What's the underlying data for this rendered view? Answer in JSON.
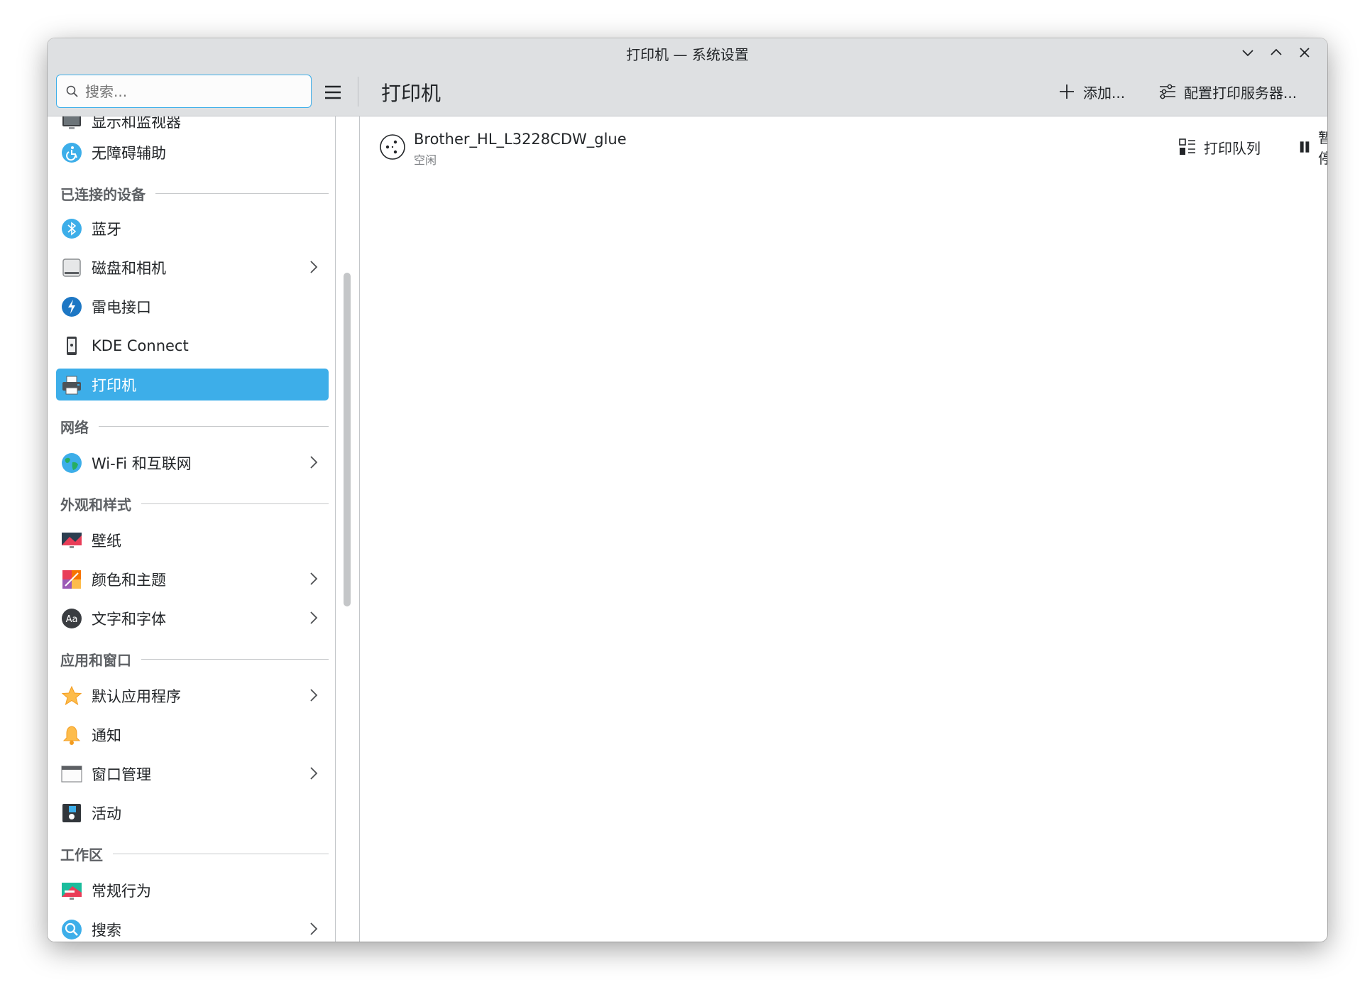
{
  "window": {
    "title": "打印机 — 系统设置"
  },
  "toolbar": {
    "search_placeholder": "搜索...",
    "page_title": "打印机",
    "add_label": "添加...",
    "configure_label": "配置打印服务器..."
  },
  "sidebar": {
    "items": [
      {
        "label": "显示和监视器",
        "icon": "monitor-icon",
        "has_chevron": false
      },
      {
        "label": "无障碍辅助",
        "icon": "accessibility-icon",
        "has_chevron": false
      },
      {
        "section": "已连接的设备"
      },
      {
        "label": "蓝牙",
        "icon": "bluetooth-icon",
        "has_chevron": false
      },
      {
        "label": "磁盘和相机",
        "icon": "disk-icon",
        "has_chevron": true
      },
      {
        "label": "雷电接口",
        "icon": "thunderbolt-icon",
        "has_chevron": false
      },
      {
        "label": "KDE Connect",
        "icon": "phone-icon",
        "has_chevron": false
      },
      {
        "label": "打印机",
        "icon": "printer-icon",
        "has_chevron": false,
        "active": true
      },
      {
        "section": "网络"
      },
      {
        "label": "Wi-Fi 和互联网",
        "icon": "globe-icon",
        "has_chevron": true
      },
      {
        "section": "外观和样式"
      },
      {
        "label": "壁纸",
        "icon": "wallpaper-icon",
        "has_chevron": false
      },
      {
        "label": "颜色和主题",
        "icon": "palette-icon",
        "has_chevron": true
      },
      {
        "label": "文字和字体",
        "icon": "font-icon",
        "has_chevron": true
      },
      {
        "section": "应用和窗口"
      },
      {
        "label": "默认应用程序",
        "icon": "star-icon",
        "has_chevron": true
      },
      {
        "label": "通知",
        "icon": "bell-icon",
        "has_chevron": false
      },
      {
        "label": "窗口管理",
        "icon": "window-icon",
        "has_chevron": true
      },
      {
        "label": "活动",
        "icon": "activities-icon",
        "has_chevron": false
      },
      {
        "section": "工作区"
      },
      {
        "label": "常规行为",
        "icon": "general-behavior-icon",
        "has_chevron": false
      },
      {
        "label": "搜索",
        "icon": "search-settings-icon",
        "has_chevron": true
      }
    ]
  },
  "printers": [
    {
      "name": "Brother_HL_L3228CDW_glue",
      "status": "空闲",
      "queue_label": "打印队列",
      "pause_label": "暂停"
    }
  ],
  "colors": {
    "accent": "#3daee9",
    "titlebar_bg": "#dee0e2",
    "text": "#232629"
  }
}
